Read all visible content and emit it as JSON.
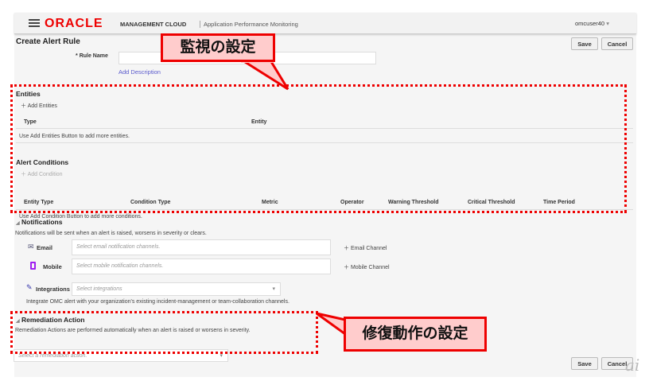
{
  "header": {
    "brand": "ORACLE",
    "product": "MANAGEMENT CLOUD",
    "app": "Application Performance Monitoring",
    "user": "omcuser40"
  },
  "page": {
    "title": "Create Alert Rule",
    "save": "Save",
    "cancel": "Cancel"
  },
  "rule": {
    "label": "Rule Name",
    "required": "*",
    "value": "",
    "add_description": "Add Description"
  },
  "entities": {
    "title": "Entities",
    "add": "Add Entities",
    "columns": [
      "Type",
      "Entity"
    ],
    "empty": "Use Add Entities Button to add more entities."
  },
  "conditions": {
    "title": "Alert Conditions",
    "add": "Add Condition",
    "columns": [
      "Entity Type",
      "Condition Type",
      "Metric",
      "Operator",
      "Warning Threshold",
      "Critical Threshold",
      "Time Period"
    ],
    "empty": "Use Add Condition Button to add more conditions."
  },
  "notifications": {
    "title": "Notifications",
    "desc": "Notifications will be sent when an alert is raised, worsens in severity or clears.",
    "email_label": "Email",
    "email_placeholder": "Select email notification channels.",
    "email_add": "Email Channel",
    "mobile_label": "Mobile",
    "mobile_placeholder": "Select mobile notification channels.",
    "mobile_add": "Mobile Channel",
    "integrations_label": "Integrations",
    "integrations_placeholder": "Select integrations",
    "integrations_desc": "Integrate OMC alert with your organization's existing incident-management or team-collaboration channels."
  },
  "remediation": {
    "title": "Remediation Action",
    "desc": "Remediation Actions are performed automatically when an alert is raised or worsens in severity.",
    "placeholder": "Select a remediation action."
  },
  "annotations": {
    "monitor": "監視の設定",
    "remediation": "修復動作の設定",
    "watermark": "ai"
  },
  "colors": {
    "annotation": "#ee0000",
    "brand": "#ee0000"
  }
}
